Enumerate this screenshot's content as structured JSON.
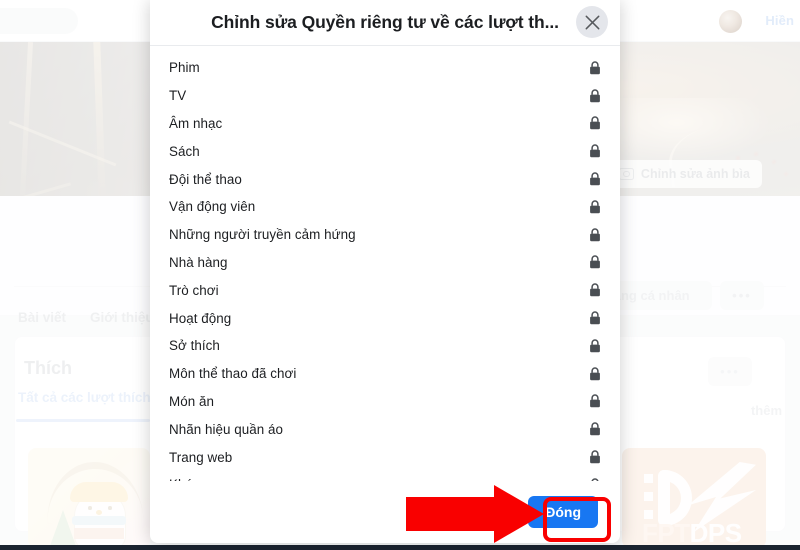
{
  "background": {
    "topbar": {
      "logo_icon": "facebook-logo-icon",
      "search_placeholder": "",
      "username": "Hiền",
      "avatar_icon": "user-avatar"
    },
    "cover": {
      "edit_cover_label": "Chỉnh sửa ảnh bìa",
      "camera_icon": "camera-icon"
    },
    "tabs": [
      "Bài viết",
      "Giới thiệu"
    ],
    "buttons": {
      "profile_label": "trang cá nhân",
      "dots_label": "•••",
      "card_dots_label": "•••"
    },
    "like_card": {
      "title": "Thích",
      "link": "Tất cả các lượt thích",
      "more_label": "thêm"
    },
    "thumbnail_right_text_1": "FPT",
    "thumbnail_right_text_2": "DPS"
  },
  "modal": {
    "title": "Chỉnh sửa Quyền riêng tư về các lượt th...",
    "close_icon": "close-icon",
    "lock_icon": "lock-icon",
    "items": [
      {
        "label": "Phim",
        "privacy_icon": "lock-icon"
      },
      {
        "label": "TV",
        "privacy_icon": "lock-icon"
      },
      {
        "label": "Âm nhạc",
        "privacy_icon": "lock-icon"
      },
      {
        "label": "Sách",
        "privacy_icon": "lock-icon"
      },
      {
        "label": "Đội thể thao",
        "privacy_icon": "lock-icon"
      },
      {
        "label": "Vận động viên",
        "privacy_icon": "lock-icon"
      },
      {
        "label": "Những người truyền cảm hứng",
        "privacy_icon": "lock-icon"
      },
      {
        "label": "Nhà hàng",
        "privacy_icon": "lock-icon"
      },
      {
        "label": "Trò chơi",
        "privacy_icon": "lock-icon"
      },
      {
        "label": "Hoạt động",
        "privacy_icon": "lock-icon"
      },
      {
        "label": "Sở thích",
        "privacy_icon": "lock-icon"
      },
      {
        "label": "Môn thể thao đã chơi",
        "privacy_icon": "lock-icon"
      },
      {
        "label": "Món ăn",
        "privacy_icon": "lock-icon"
      },
      {
        "label": "Nhãn hiệu quần áo",
        "privacy_icon": "lock-icon"
      },
      {
        "label": "Trang web",
        "privacy_icon": "lock-icon"
      },
      {
        "label": "Khác",
        "privacy_icon": "lock-icon"
      }
    ],
    "footer": {
      "close_label": "Đóng"
    }
  },
  "annotations": {
    "arrow_color": "#f90000",
    "highlight_color": "#f90000",
    "accent_color": "#1877f2"
  }
}
